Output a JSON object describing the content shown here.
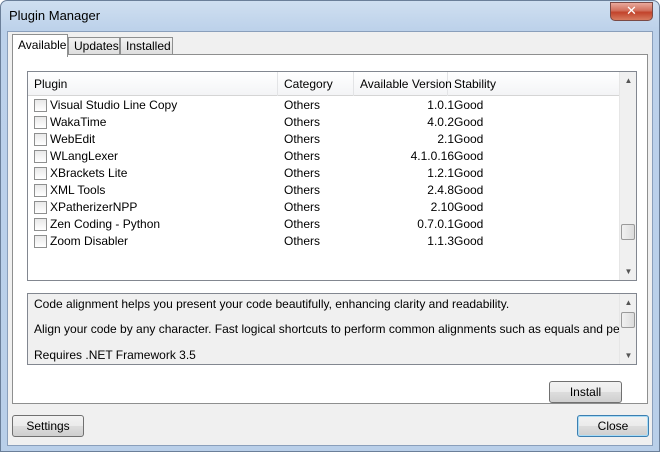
{
  "window": {
    "title": "Plugin Manager",
    "close_glyph": "✕"
  },
  "tabs": [
    {
      "label": "Available",
      "active": true
    },
    {
      "label": "Updates",
      "active": false
    },
    {
      "label": "Installed",
      "active": false
    }
  ],
  "grid": {
    "columns": [
      "Plugin",
      "Category",
      "Available Version",
      "Stability"
    ],
    "rows": [
      {
        "name": "Visual Studio Line Copy",
        "category": "Others",
        "version": "1.0.1",
        "stability": "Good",
        "checked": false
      },
      {
        "name": "WakaTime",
        "category": "Others",
        "version": "4.0.2",
        "stability": "Good",
        "checked": false
      },
      {
        "name": "WebEdit",
        "category": "Others",
        "version": "2.1",
        "stability": "Good",
        "checked": false
      },
      {
        "name": "WLangLexer",
        "category": "Others",
        "version": "4.1.0.16",
        "stability": "Good",
        "checked": false
      },
      {
        "name": "XBrackets Lite",
        "category": "Others",
        "version": "1.2.1",
        "stability": "Good",
        "checked": false
      },
      {
        "name": "XML Tools",
        "category": "Others",
        "version": "2.4.8",
        "stability": "Good",
        "checked": false
      },
      {
        "name": "XPatherizerNPP",
        "category": "Others",
        "version": "2.10",
        "stability": "Good",
        "checked": false
      },
      {
        "name": "Zen Coding - Python",
        "category": "Others",
        "version": "0.7.0.1",
        "stability": "Good",
        "checked": false
      },
      {
        "name": "Zoom Disabler",
        "category": "Others",
        "version": "1.1.3",
        "stability": "Good",
        "checked": false
      }
    ]
  },
  "description": {
    "lines": [
      "Code alignment helps you present your code beautifully, enhancing clarity and readability.",
      "Align your code by any character. Fast logical shortcuts to perform common alignments such as equals and period.",
      "Requires .NET Framework 3.5"
    ]
  },
  "buttons": {
    "install": "Install",
    "settings": "Settings",
    "close": "Close"
  },
  "icons": {
    "scroll_up": "▲",
    "scroll_down": "▼"
  }
}
